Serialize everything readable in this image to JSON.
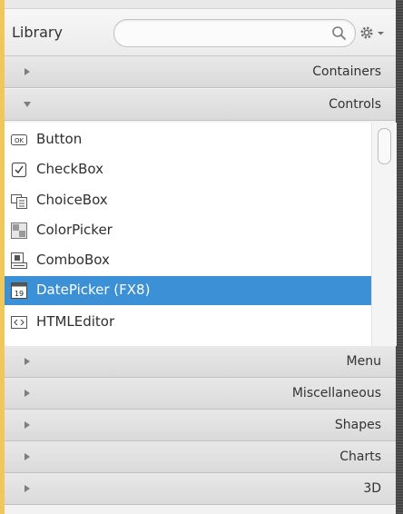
{
  "library": {
    "title": "Library",
    "search_value": "",
    "search_icon": "search-icon",
    "gear_icon": "gear-icon"
  },
  "sections": {
    "containers": "Containers",
    "controls": "Controls",
    "menu": "Menu",
    "miscellaneous": "Miscellaneous",
    "shapes": "Shapes",
    "charts": "Charts",
    "three_d": "3D"
  },
  "controls_items": [
    {
      "label": "Button",
      "icon": "button-icon"
    },
    {
      "label": "CheckBox",
      "icon": "checkbox-icon"
    },
    {
      "label": "ChoiceBox",
      "icon": "choicebox-icon"
    },
    {
      "label": "ColorPicker",
      "icon": "colorpicker-icon"
    },
    {
      "label": "ComboBox",
      "icon": "combobox-icon"
    },
    {
      "label": "DatePicker   (FX8)",
      "icon": "datepicker-icon",
      "selected": true
    },
    {
      "label": "HTMLEditor",
      "icon": "htmleditor-icon"
    }
  ],
  "colors": {
    "selection": "#3c90d6",
    "accent_strip": "#f0c85a"
  }
}
